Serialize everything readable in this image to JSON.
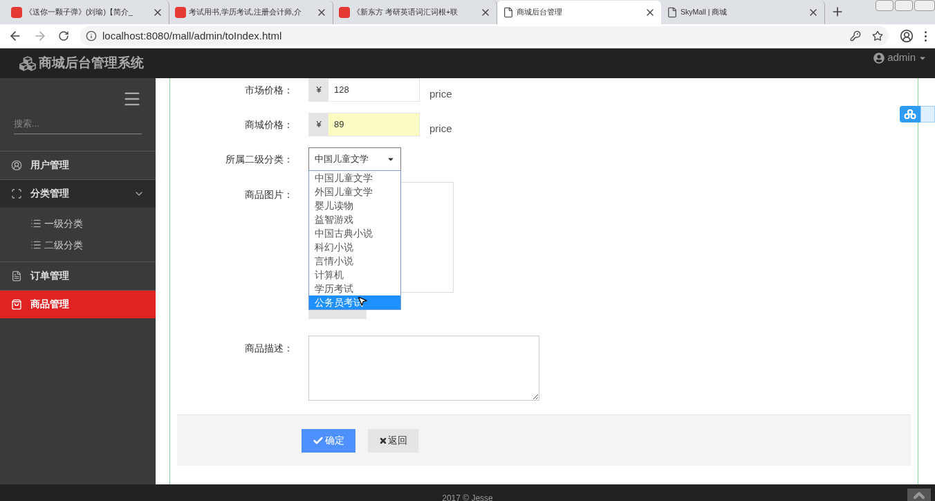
{
  "browser": {
    "tabs": [
      {
        "title": "《送你一颗子弹》(刘瑜)【简介_",
        "kind": "app",
        "selected": false
      },
      {
        "title": "考试用书,学历考试,注册会计师,介",
        "kind": "app",
        "selected": false
      },
      {
        "title": "《新东方 考研英语词汇词根+联",
        "kind": "app",
        "selected": false
      },
      {
        "title": "商城后台管理",
        "kind": "page",
        "selected": true
      },
      {
        "title": "SkyMall | 商城",
        "kind": "page",
        "selected": false
      }
    ],
    "url": "localhost:8080/mall/admin/toIndex.html"
  },
  "app": {
    "title": "商城后台管理系统",
    "user": "admin"
  },
  "sidebar": {
    "search": {
      "placeholder": "搜索..."
    },
    "items": [
      {
        "label": "用户管理",
        "selected": false
      },
      {
        "label": "分类管理",
        "expanded": true,
        "selected": false,
        "children": [
          {
            "label": "一级分类"
          },
          {
            "label": "二级分类"
          }
        ]
      },
      {
        "label": "订单管理",
        "selected": false
      },
      {
        "label": "商品管理",
        "selected": true
      }
    ]
  },
  "form": {
    "fields": [
      {
        "kind": "price",
        "label": "市场价格：",
        "prefix": "¥",
        "value": "128",
        "unit": "price",
        "focused": false
      },
      {
        "kind": "price",
        "label": "商城价格：",
        "prefix": "¥",
        "value": "89",
        "unit": "price",
        "focused": true
      },
      {
        "kind": "select",
        "label": "所属二级分类：",
        "value": "中国儿童文学",
        "options": [
          {
            "label": "中国儿童文学",
            "highlighted": false
          },
          {
            "label": "外国儿童文学",
            "highlighted": false
          },
          {
            "label": "婴儿读物",
            "highlighted": false
          },
          {
            "label": "益智游戏",
            "highlighted": false
          },
          {
            "label": "中国古典小说",
            "highlighted": false
          },
          {
            "label": "科幻小说",
            "highlighted": false
          },
          {
            "label": "言情小说",
            "highlighted": false
          },
          {
            "label": "计算机",
            "highlighted": false
          },
          {
            "label": "学历考试",
            "highlighted": false
          },
          {
            "label": "公务员考试",
            "highlighted": true
          }
        ]
      },
      {
        "kind": "image",
        "label": "商品图片："
      },
      {
        "kind": "textarea",
        "label": "商品描述："
      }
    ],
    "buttons": [
      {
        "label": "确定",
        "kind": "primary"
      },
      {
        "label": "返回",
        "kind": "secondary"
      }
    ]
  },
  "footer": "2017 © Jesse"
}
